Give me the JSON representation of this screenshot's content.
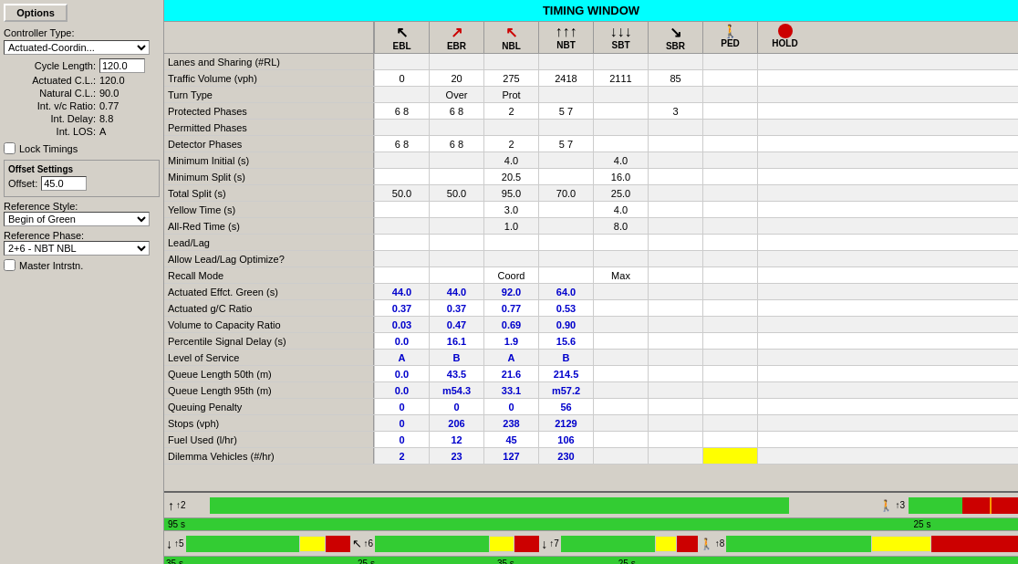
{
  "app": {
    "title": "TIMING WINDOW"
  },
  "left_panel": {
    "options_label": "Options",
    "controller_type_label": "Controller Type:",
    "controller_type_value": "Actuated-Coordin...",
    "cycle_length_label": "Cycle Length:",
    "cycle_length_value": "120.0",
    "actuated_cl_label": "Actuated C.L.:",
    "actuated_cl_value": "120.0",
    "natural_cl_label": "Natural C.L.:",
    "natural_cl_value": "90.0",
    "int_vc_label": "Int. v/c Ratio:",
    "int_vc_value": "0.77",
    "int_delay_label": "Int. Delay:",
    "int_delay_value": "8.8",
    "int_los_label": "Int. LOS:",
    "int_los_value": "A",
    "lock_timings_label": "Lock Timings",
    "offset_settings_label": "Offset Settings",
    "offset_label": "Offset:",
    "offset_value": "45.0",
    "reference_style_label": "Reference Style:",
    "reference_style_value": "Begin of Green",
    "reference_phase_label": "Reference Phase:",
    "reference_phase_value": "2+6 - NBT NBL",
    "master_intsctn_label": "Master Intrstn."
  },
  "columns": [
    {
      "id": "EBL",
      "label": "EBL",
      "icon": "↖"
    },
    {
      "id": "EBR",
      "label": "EBR",
      "icon": "↗"
    },
    {
      "id": "NBL",
      "label": "NBL",
      "icon": "↖"
    },
    {
      "id": "NBT",
      "label": "NBT",
      "icon": "↑"
    },
    {
      "id": "SBT",
      "label": "SBT",
      "icon": "↓"
    },
    {
      "id": "SBR",
      "label": "SBR",
      "icon": "↘"
    },
    {
      "id": "PED",
      "label": "PED",
      "icon": "🚶"
    },
    {
      "id": "HOLD",
      "label": "HOLD",
      "icon": "●"
    }
  ],
  "rows": [
    {
      "label": "Lanes and Sharing (#RL)",
      "cells": [
        "",
        "",
        "",
        "",
        "",
        "",
        "",
        ""
      ]
    },
    {
      "label": "Traffic Volume (vph)",
      "cells": [
        "0",
        "20",
        "275",
        "2418",
        "2111",
        "85",
        "",
        ""
      ]
    },
    {
      "label": "Turn Type",
      "cells": [
        "",
        "Over",
        "Prot",
        "",
        "",
        "",
        "",
        ""
      ]
    },
    {
      "label": "Protected Phases",
      "cells": [
        "6 8",
        "6 8",
        "2",
        "5 7",
        "",
        "3",
        "",
        ""
      ]
    },
    {
      "label": "Permitted Phases",
      "cells": [
        "",
        "",
        "",
        "",
        "",
        "",
        "",
        ""
      ]
    },
    {
      "label": "Detector Phases",
      "cells": [
        "6 8",
        "6 8",
        "2",
        "5 7",
        "",
        "",
        "",
        ""
      ]
    },
    {
      "label": "Minimum Initial (s)",
      "cells": [
        "",
        "",
        "4.0",
        "",
        "4.0",
        "",
        "",
        ""
      ]
    },
    {
      "label": "Minimum Split (s)",
      "cells": [
        "",
        "",
        "20.5",
        "",
        "16.0",
        "",
        "",
        ""
      ]
    },
    {
      "label": "Total Split (s)",
      "cells": [
        "50.0",
        "50.0",
        "95.0",
        "70.0",
        "25.0",
        "",
        "",
        ""
      ]
    },
    {
      "label": "Yellow Time (s)",
      "cells": [
        "",
        "",
        "3.0",
        "",
        "4.0",
        "",
        "",
        ""
      ]
    },
    {
      "label": "All-Red Time (s)",
      "cells": [
        "",
        "",
        "1.0",
        "",
        "8.0",
        "",
        "",
        ""
      ]
    },
    {
      "label": "Lead/Lag",
      "cells": [
        "",
        "",
        "",
        "",
        "",
        "",
        "",
        ""
      ]
    },
    {
      "label": "Allow Lead/Lag Optimize?",
      "cells": [
        "",
        "",
        "",
        "",
        "",
        "",
        "",
        ""
      ]
    },
    {
      "label": "Recall Mode",
      "cells": [
        "",
        "",
        "Coord",
        "",
        "Max",
        "",
        "",
        ""
      ]
    },
    {
      "label": "Actuated Effct. Green (s)",
      "cells": [
        "44.0",
        "44.0",
        "92.0",
        "64.0",
        "",
        "",
        "",
        ""
      ],
      "blue": true
    },
    {
      "label": "Actuated g/C Ratio",
      "cells": [
        "0.37",
        "0.37",
        "0.77",
        "0.53",
        "",
        "",
        "",
        ""
      ],
      "blue": true
    },
    {
      "label": "Volume to Capacity Ratio",
      "cells": [
        "0.03",
        "0.47",
        "0.69",
        "0.90",
        "",
        "",
        "",
        ""
      ],
      "blue": true
    },
    {
      "label": "Percentile Signal Delay (s)",
      "cells": [
        "0.0",
        "16.1",
        "1.9",
        "15.6",
        "",
        "",
        "",
        ""
      ],
      "blue": true
    },
    {
      "label": "Level of Service",
      "cells": [
        "A",
        "B",
        "A",
        "B",
        "",
        "",
        "",
        ""
      ],
      "blue": true
    },
    {
      "label": "Queue Length 50th (m)",
      "cells": [
        "0.0",
        "43.5",
        "21.6",
        "214.5",
        "",
        "",
        "",
        ""
      ],
      "blue": true
    },
    {
      "label": "Queue Length 95th (m)",
      "cells": [
        "0.0",
        "m54.3",
        "33.1",
        "m57.2",
        "",
        "",
        "",
        ""
      ],
      "blue": true
    },
    {
      "label": "Queuing Penalty",
      "cells": [
        "0",
        "0",
        "0",
        "56",
        "",
        "",
        "",
        ""
      ],
      "blue": true
    },
    {
      "label": "Stops (vph)",
      "cells": [
        "0",
        "206",
        "238",
        "2129",
        "",
        "",
        "",
        ""
      ],
      "blue": true
    },
    {
      "label": "Fuel Used (l/hr)",
      "cells": [
        "0",
        "12",
        "45",
        "106",
        "",
        "",
        "",
        ""
      ],
      "blue": true
    },
    {
      "label": "Dilemma Vehicles (#/hr)",
      "cells": [
        "2",
        "23",
        "127",
        "230",
        "",
        "",
        "",
        ""
      ],
      "blue": true,
      "last_yellow": true
    }
  ],
  "phase_timeline": {
    "rows": [
      {
        "phase_id": "↑2",
        "ped_icon": false,
        "label": "↑ ↑2",
        "ped_label": "🚶 ↑3",
        "segments_left": [
          {
            "type": "green",
            "pct": 88
          },
          {
            "type": "other",
            "pct": 12
          }
        ],
        "segments_right": [
          {
            "type": "green",
            "pct": 50
          },
          {
            "type": "red",
            "pct": 50
          }
        ],
        "left_duration": "95 s",
        "right_duration": "25 s"
      },
      {
        "label": "↓ ↓5",
        "label2": "↖ ↑6",
        "label3": "↓ ↓7",
        "label4": "🚶 ↑8",
        "seg1": "35 s",
        "seg2": "25 s",
        "seg3": "35 s",
        "seg4": "25 s"
      }
    ]
  }
}
